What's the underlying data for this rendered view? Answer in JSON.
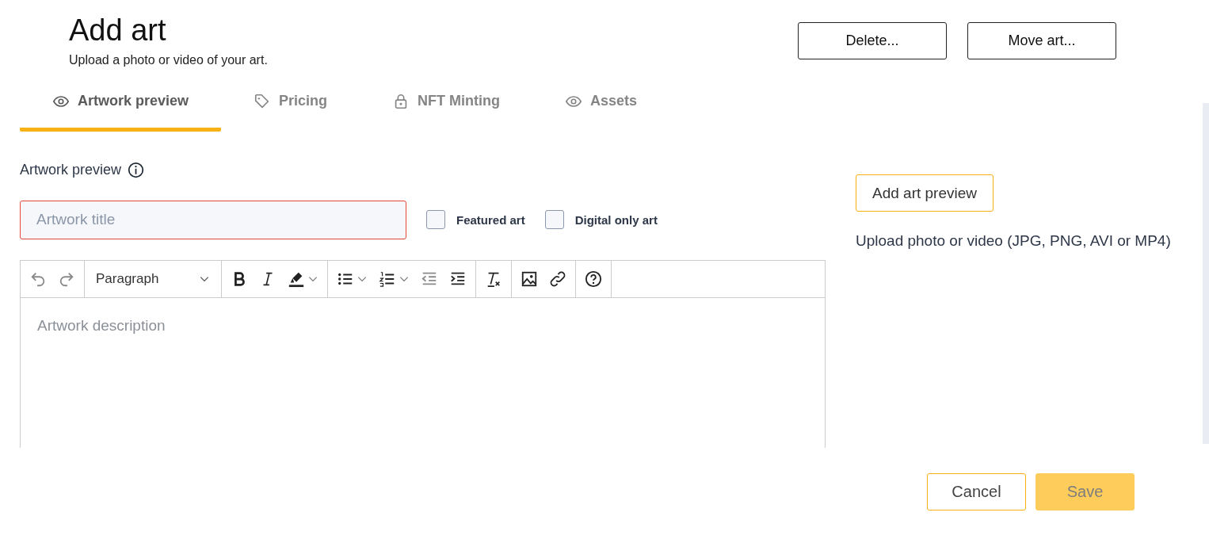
{
  "header": {
    "title": "Add art",
    "subtitle": "Upload a photo or video of your art.",
    "actions": [
      {
        "label": "Delete..."
      },
      {
        "label": "Move art..."
      }
    ]
  },
  "tabs": [
    {
      "label": "Artwork preview",
      "kind": "eye",
      "selected": true
    },
    {
      "label": "Pricing",
      "kind": "tag",
      "selected": false
    },
    {
      "label": "NFT Minting",
      "kind": "lock",
      "selected": false
    },
    {
      "label": "Assets",
      "kind": "eye",
      "selected": false
    }
  ],
  "section": {
    "label": "Artwork preview"
  },
  "title_field": {
    "placeholder": "Artwork title",
    "error": true
  },
  "checkboxes": [
    {
      "label": "Featured art",
      "checked": false
    },
    {
      "label": "Digital only art",
      "checked": false
    }
  ],
  "toolbar": [
    [
      {
        "kind": "undo",
        "disabled": true
      },
      {
        "kind": "redo",
        "disabled": true
      }
    ],
    [
      {
        "kind": "block",
        "label": "Paragraph"
      }
    ],
    [
      {
        "kind": "bold",
        "disabled": false
      },
      {
        "kind": "italic",
        "disabled": false
      },
      {
        "kind": "highlight",
        "disabled": false
      }
    ],
    [
      {
        "kind": "bullets",
        "disabled": false
      },
      {
        "kind": "numbers",
        "disabled": false
      },
      {
        "kind": "outdent",
        "disabled": true
      },
      {
        "kind": "indent",
        "disabled": false
      }
    ],
    [
      {
        "kind": "clear",
        "disabled": false
      }
    ],
    [
      {
        "kind": "image",
        "disabled": false
      },
      {
        "kind": "link",
        "disabled": false
      }
    ],
    [
      {
        "kind": "help",
        "disabled": false
      }
    ]
  ],
  "description_field": {
    "placeholder": "Artwork description"
  },
  "preview": {
    "button": "Add art preview",
    "hint": "Upload photo or video (JPG, PNG, AVI or MP4)"
  },
  "footer": {
    "cancel": {
      "label": "Cancel",
      "disabled": false
    },
    "save": {
      "label": "Save",
      "disabled": true
    }
  }
}
